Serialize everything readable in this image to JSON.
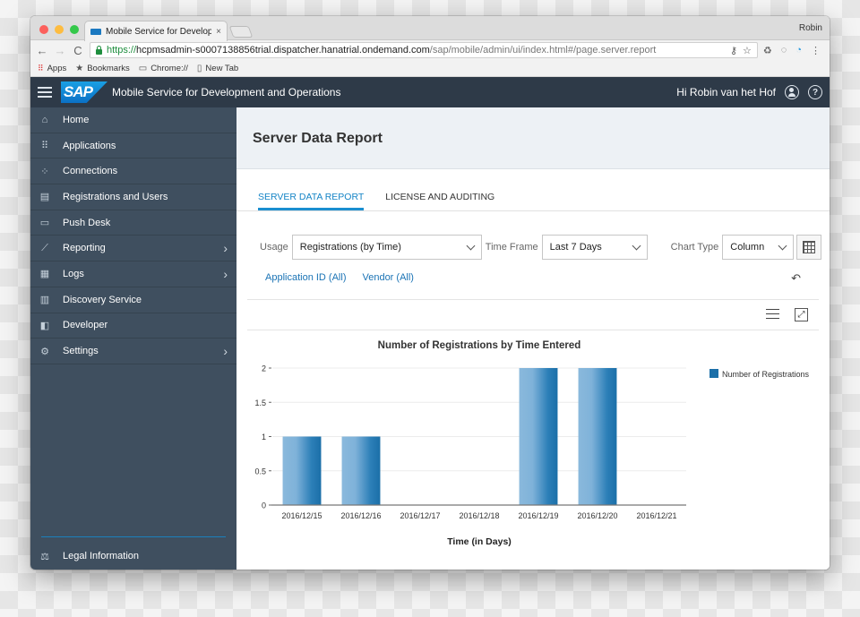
{
  "browser": {
    "tab_title": "Mobile Service for Development and Operations",
    "tab_close": "×",
    "profile_name": "Robin",
    "url_scheme": "https://",
    "url_host": "hcpmsadmin-s0007138856trial.dispatcher.hanatrial.ondemand.com",
    "url_path": "/sap/mobile/admin/ui/index.html#/page.server.report",
    "nav": {
      "back": "←",
      "forward": "→",
      "reload": "C"
    },
    "omnibox_icons": [
      "key-icon",
      "star-icon"
    ],
    "extension_icons": [
      "recycle-icon",
      "circle-ext-icon",
      "sync-ext-icon",
      "menu-dots-icon"
    ],
    "bookmarks": [
      {
        "label": "Apps",
        "icon": "apps-grid-icon"
      },
      {
        "label": "Bookmarks",
        "icon": "star-icon"
      },
      {
        "label": "Chrome://",
        "icon": "folder-icon"
      },
      {
        "label": "New Tab",
        "icon": "page-icon"
      }
    ]
  },
  "shell": {
    "logo_text": "SAP",
    "title": "Mobile Service for Development and Operations",
    "greeting": "Hi Robin van het Hof",
    "user_icon": "user-icon",
    "help_icon": "?"
  },
  "sidebar": {
    "items": [
      {
        "label": "Home",
        "icon": "⌂",
        "expandable": false
      },
      {
        "label": "Applications",
        "icon": "⠿",
        "expandable": false
      },
      {
        "label": "Connections",
        "icon": "⁘",
        "expandable": false
      },
      {
        "label": "Registrations and Users",
        "icon": "▤",
        "expandable": false
      },
      {
        "label": "Push Desk",
        "icon": "▭",
        "expandable": false
      },
      {
        "label": "Reporting",
        "icon": "⟋",
        "expandable": true
      },
      {
        "label": "Logs",
        "icon": "▦",
        "expandable": true
      },
      {
        "label": "Discovery Service",
        "icon": "▥",
        "expandable": false
      },
      {
        "label": "Developer",
        "icon": "◧",
        "expandable": false
      },
      {
        "label": "Settings",
        "icon": "⚙",
        "expandable": true
      }
    ],
    "chevron": "›",
    "footer": {
      "label": "Legal Information",
      "icon": "⚖"
    }
  },
  "page": {
    "title": "Server Data Report",
    "tabs": [
      {
        "label": "SERVER DATA REPORT",
        "active": true
      },
      {
        "label": "LICENSE AND AUDITING",
        "active": false
      }
    ],
    "filters": {
      "usage_label": "Usage",
      "usage_value": "Registrations (by Time)",
      "timeframe_label": "Time Frame",
      "timeframe_value": "Last 7 Days",
      "charttype_label": "Chart Type",
      "charttype_value": "Column"
    },
    "links": [
      "Application ID (All)",
      "Vendor (All)"
    ],
    "undo_icon": "↶",
    "expand_icon": "⤢"
  },
  "colors": {
    "shell_bg": "#2e3a48",
    "sidebar_bg": "#3f4f5f",
    "accent": "#1a8ed0",
    "bar_dark": "#1b6fa8",
    "bar_light": "#8ab9dc"
  },
  "chart_data": {
    "type": "bar",
    "title": "Number of Registrations by Time Entered",
    "xlabel": "Time (in Days)",
    "ylabel": "",
    "categories": [
      "2016/12/15",
      "2016/12/16",
      "2016/12/17",
      "2016/12/18",
      "2016/12/19",
      "2016/12/20",
      "2016/12/21"
    ],
    "series": [
      {
        "name": "Number of Registrations",
        "values": [
          1,
          1,
          0,
          0,
          2,
          2,
          0
        ]
      }
    ],
    "ylim": [
      0,
      2
    ],
    "yticks": [
      0,
      0.5,
      1,
      1.5,
      2
    ],
    "ytick_labels": [
      "0",
      "0.5",
      "1",
      "1.5",
      "2"
    ],
    "grid": true,
    "legend_position": "right"
  }
}
